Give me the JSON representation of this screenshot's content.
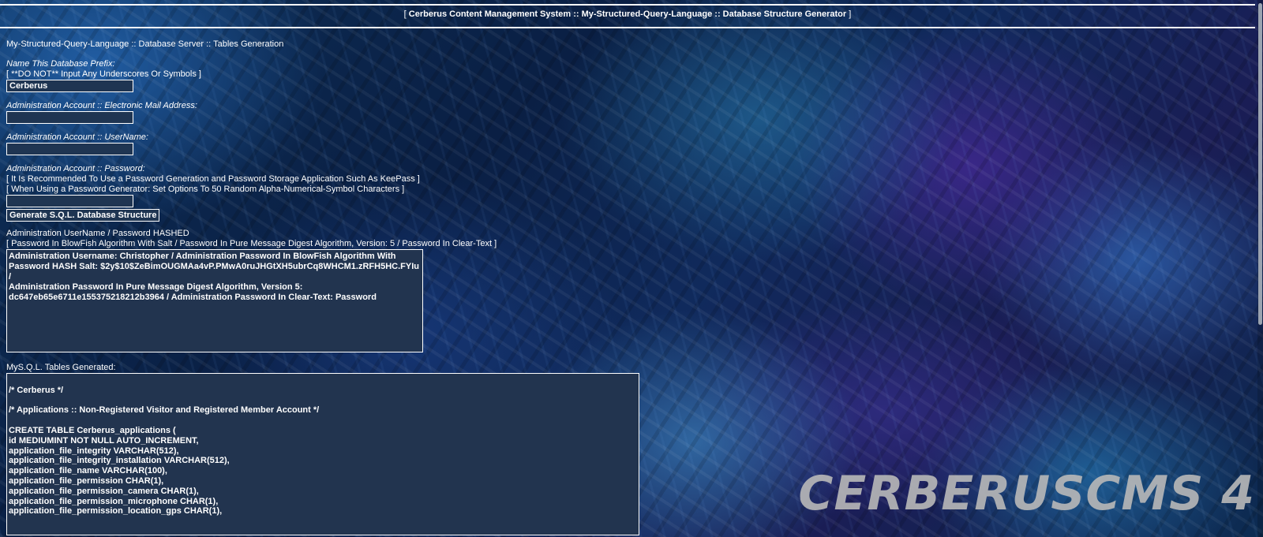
{
  "window": {
    "title_prefix": "[",
    "title": "Cerberus Content Management System :: My-Structured-Query-Language :: Database Structure Generator",
    "title_suffix": "]"
  },
  "page": {
    "heading": "My-Structured-Query-Language :: Database Server :: Tables Generation"
  },
  "form": {
    "prefix_label": "Name This Database Prefix:",
    "prefix_note": "[ **DO NOT** Input Any Underscores Or Symbols ]",
    "prefix_value": "Cerberus",
    "email_label": "Administration Account :: Electronic Mail Address:",
    "email_value": "",
    "username_label": "Administration Account :: UserName:",
    "username_value": "",
    "password_label": "Administration Account :: Password:",
    "password_note_1": "[ It Is Recommended To Use a Password Generation and Password Storage Application Such As KeePass ]",
    "password_note_2": "[ When Using a Password Generator: Set Options To 50 Random Alpha-Numerical-Symbol Characters ]",
    "password_value": "",
    "generate_button": "Generate S.Q.L. Database Structure"
  },
  "hashed": {
    "heading": "Administration UserName / Password HASHED",
    "note": "[ Password In BlowFish Algorithm With Salt / Password In Pure Message Digest Algorithm, Version: 5 / Password In Clear-Text ]",
    "lines": [
      "Administration Username: Christopher / Administration Password In BlowFish Algorithm With",
      "Password HASH Salt: $2y$10$ZeBimOUGMAa4vP.PMwA0ruJHGtXH5ubrCq8WHCM1.zRFH5HC.FYIu /",
      "Administration Password In Pure Message Digest Algorithm, Version 5:",
      "dc647eb65e6711e155375218212b3964 / Administration Password In Clear-Text: Password"
    ]
  },
  "sql": {
    "heading": "MyS.Q.L. Tables Generated:",
    "lines": [
      "",
      "/* Cerberus */",
      "",
      "/* Applications :: Non-Registered Visitor and Registered Member Account */",
      "",
      "CREATE TABLE Cerberus_applications (",
      "id MEDIUMINT NOT NULL AUTO_INCREMENT,",
      "application_file_integrity VARCHAR(512),",
      "application_file_integrity_installation VARCHAR(512),",
      "application_file_name VARCHAR(100),",
      "application_file_permission CHAR(1),",
      "application_file_permission_camera CHAR(1),",
      "application_file_permission_microphone CHAR(1),",
      "application_file_permission_location_gps CHAR(1),"
    ]
  },
  "branding": {
    "watermark": "CERBERUSCMS 4"
  }
}
